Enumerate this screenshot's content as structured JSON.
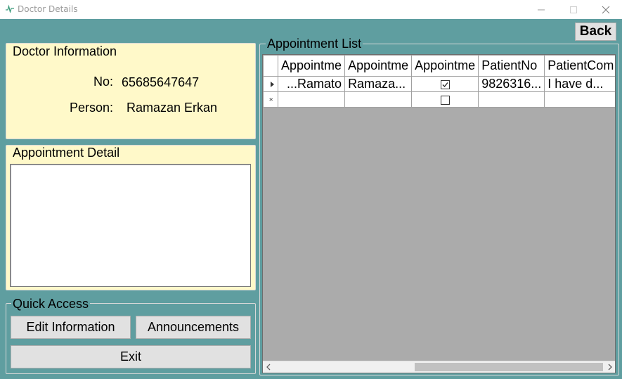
{
  "window": {
    "title": "Doctor Details",
    "icon": "heartbeat-icon",
    "controls": [
      "minimize-icon",
      "maximize-icon",
      "close-icon"
    ]
  },
  "back_button": "Back",
  "doctor_info": {
    "title": "Doctor Information",
    "no_label": "No:",
    "no_value": "65685647647",
    "person_label": "Person:",
    "person_value": "Ramazan Erkan"
  },
  "appointment_detail": {
    "title": "Appointment Detail",
    "value": ""
  },
  "quick_access": {
    "title": "Quick Access",
    "edit_button": "Edit Information",
    "announcements_button": "Announcements",
    "exit_button": "Exit"
  },
  "appointment_list": {
    "title": "Appointment List",
    "columns": [
      "Appointme",
      "Appointme",
      "Appointme",
      "PatientNo",
      "PatientCom"
    ],
    "rows": [
      {
        "indicator": "current-row-icon",
        "cells": [
          "Ramato...",
          "Ramaza...",
          "",
          "9826316...",
          "I have d..."
        ],
        "checked": true
      },
      {
        "indicator": "new-row-icon",
        "cells": [
          "",
          "",
          "",
          "",
          ""
        ],
        "checked": false
      }
    ]
  },
  "colors": {
    "form_background": "#5f9ea0",
    "panel_yellow": "#fff9c9",
    "grid_background": "#ababab"
  }
}
